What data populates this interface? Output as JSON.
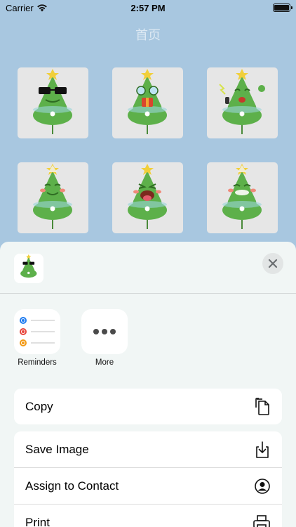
{
  "status_bar": {
    "carrier": "Carrier",
    "time": "2:57 PM"
  },
  "nav": {
    "title": "首页"
  },
  "stickers": [
    {
      "pose": "sunglasses"
    },
    {
      "pose": "goggles-gift"
    },
    {
      "pose": "mic-sparkle"
    },
    {
      "pose": "smile"
    },
    {
      "pose": "tongue-out"
    },
    {
      "pose": "content"
    }
  ],
  "share_sheet": {
    "close_icon": "close-icon",
    "apps": [
      {
        "label": "Reminders",
        "icon": "reminders-icon"
      },
      {
        "label": "More",
        "icon": "more-icon"
      }
    ],
    "actions": [
      {
        "label": "Copy",
        "icon": "copy-icon"
      },
      {
        "label": "Save Image",
        "icon": "save-image-icon"
      },
      {
        "label": "Assign to Contact",
        "icon": "contact-icon"
      },
      {
        "label": "Print",
        "icon": "print-icon"
      }
    ]
  },
  "colors": {
    "background": "#a8c7e0",
    "sheet": "#f1f6f5",
    "tile": "#e6e6e6",
    "character_green": "#5db04a",
    "reminder_blue": "#1f7cf0",
    "reminder_red": "#e8453c",
    "reminder_orange": "#f29a16"
  }
}
